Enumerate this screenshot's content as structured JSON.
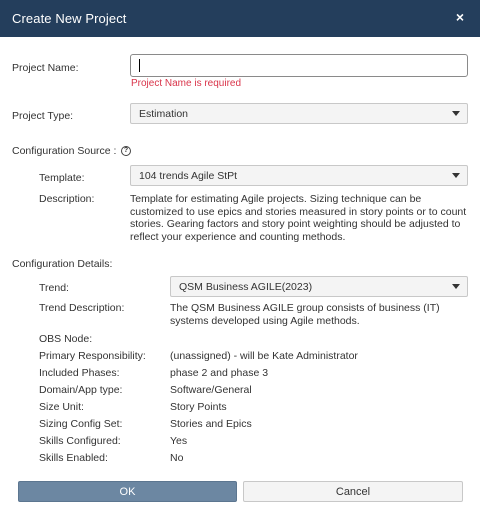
{
  "dialog": {
    "title": "Create New Project",
    "close_icon": "close-icon",
    "close_glyph": "×"
  },
  "project_name": {
    "label": "Project Name:",
    "value": "",
    "error": "Project Name is required"
  },
  "project_type": {
    "label": "Project Type:",
    "selected": "Estimation"
  },
  "configuration_source": {
    "label": "Configuration Source :",
    "help_icon": "help-icon",
    "help_glyph": "?",
    "template_label": "Template:",
    "template_selected": "104 trends Agile StPt",
    "description_label": "Description:",
    "description_text": "Template for estimating Agile projects. Sizing technique can be customized to use epics and stories measured in story points or to count stories. Gearing factors and story point weighting should be adjusted to reflect your experience and counting methods."
  },
  "configuration_details": {
    "label": "Configuration Details:",
    "trend_label": "Trend:",
    "trend_selected": "QSM Business AGILE(2023)",
    "trend_description_label": "Trend Description:",
    "trend_description_text": "The QSM Business AGILE group consists of business (IT) systems developed using Agile methods.",
    "rows": [
      {
        "label": "OBS Node:",
        "value": ""
      },
      {
        "label": "Primary Responsibility:",
        "value": "(unassigned) - will be Kate Administrator"
      },
      {
        "label": "Included Phases:",
        "value": "phase 2 and phase 3"
      },
      {
        "label": "Domain/App type:",
        "value": "Software/General"
      },
      {
        "label": "Size Unit:",
        "value": "Story Points"
      },
      {
        "label": "Sizing Config Set:",
        "value": "Stories and Epics"
      },
      {
        "label": "Skills Configured:",
        "value": "Yes"
      },
      {
        "label": "Skills Enabled:",
        "value": "No"
      }
    ]
  },
  "buttons": {
    "ok": "OK",
    "cancel": "Cancel"
  },
  "colors": {
    "titlebar": "#243e5c",
    "error": "#d9344a",
    "ok_button": "#6c87a2"
  }
}
